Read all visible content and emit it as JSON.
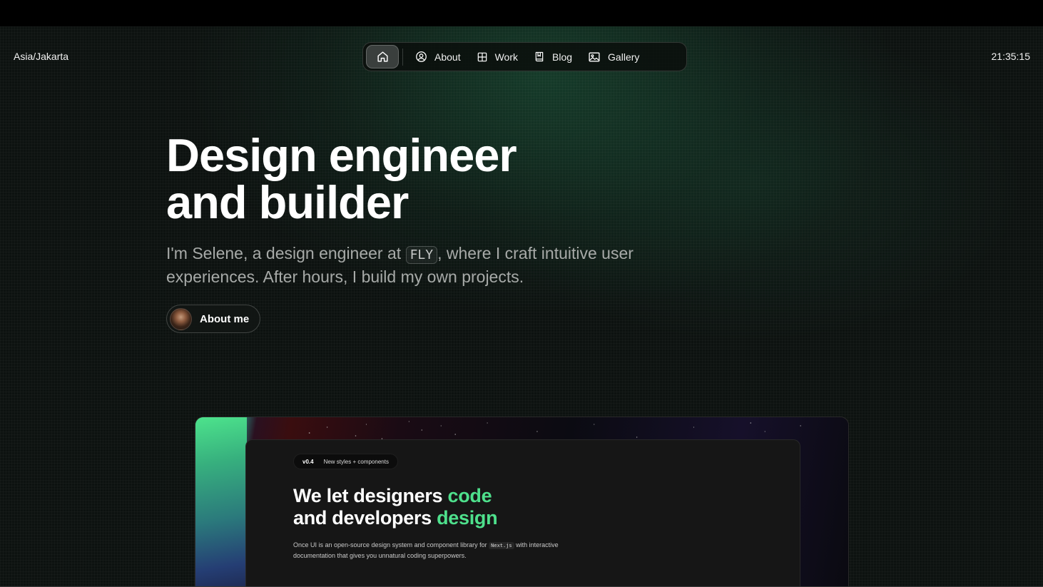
{
  "header": {
    "timezone": "Asia/Jakarta",
    "time": "21:35:15"
  },
  "nav": {
    "items": [
      {
        "label": "About",
        "icon": "person-circle-icon"
      },
      {
        "label": "Work",
        "icon": "grid-icon"
      },
      {
        "label": "Blog",
        "icon": "book-icon"
      },
      {
        "label": "Gallery",
        "icon": "image-icon"
      }
    ],
    "home_icon": "home-icon"
  },
  "hero": {
    "title_line1": "Design engineer",
    "title_line2": "and builder",
    "sub_before": "I'm Selene, a design engineer at ",
    "sub_code": "FLY",
    "sub_after": ", where I craft intuitive user experiences. After hours, I build my own projects.",
    "about_button": "About me"
  },
  "preview": {
    "badge_version": "v0.4",
    "badge_text": "New styles + components",
    "title_a": "We let designers ",
    "title_hl1": "code",
    "title_b": "and developers ",
    "title_hl2": "design",
    "desc_before": "Once UI is an open-source design system and component library for ",
    "desc_code": "Next.js",
    "desc_after": " with interactive documentation that gives you unnatural coding superpowers."
  },
  "colors": {
    "accent": "#4ee08c",
    "background": "#0d1210"
  }
}
